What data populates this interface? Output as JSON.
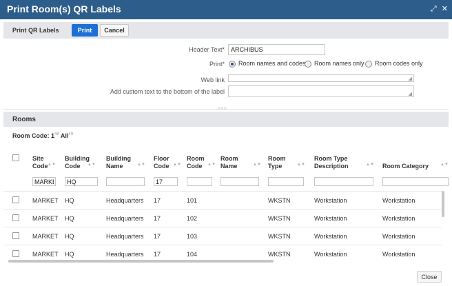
{
  "window": {
    "title": "Print Room(s) QR Labels",
    "icons": [
      "expand-icon",
      "close-icon"
    ],
    "expand_glyph": "⤢",
    "close_glyph": "✕"
  },
  "actionbar": {
    "label": "Print QR Labels",
    "print_button": "Print",
    "cancel_button": "Cancel"
  },
  "form": {
    "header_text_label": "Header Text*",
    "header_text_value": "ARCHIBUS",
    "print_label": "Print*",
    "print_options": [
      "Room names and codes",
      "Room names only",
      "Room codes only"
    ],
    "print_selected": "Room names and codes",
    "web_link_label": "Web link",
    "web_link_value": "",
    "custom_text_label": "Add custom text to the bottom of the label",
    "custom_text_value": ""
  },
  "rooms": {
    "title": "Rooms",
    "filter_label": "Room Code:",
    "filter_selected": "1",
    "filter_selected_count": "49",
    "filter_all": "All",
    "filter_all_count": "49",
    "columns": [
      {
        "line1": "Site",
        "line2": "Code"
      },
      {
        "line1": "Building",
        "line2": "Code"
      },
      {
        "line1": "Building",
        "line2": "Name"
      },
      {
        "line1": "Floor",
        "line2": "Code"
      },
      {
        "line1": "Room",
        "line2": "Code"
      },
      {
        "line1": "Room",
        "line2": "Name"
      },
      {
        "line1": "Room",
        "line2": "Type"
      },
      {
        "line1": "Room Type",
        "line2": "Description"
      },
      {
        "line1": "",
        "line2": "Room Category"
      }
    ],
    "filters": [
      "MARKET",
      "HQ",
      "",
      "17",
      "",
      "",
      "",
      "",
      ""
    ],
    "rows": [
      [
        "MARKET",
        "HQ",
        "Headquarters",
        "17",
        "101",
        "",
        "WKSTN",
        "Workstation",
        "Workstation"
      ],
      [
        "MARKET",
        "HQ",
        "Headquarters",
        "17",
        "102",
        "",
        "WKSTN",
        "Workstation",
        "Workstation"
      ],
      [
        "MARKET",
        "HQ",
        "Headquarters",
        "17",
        "103",
        "",
        "WKSTN",
        "Workstation",
        "Workstation"
      ],
      [
        "MARKET",
        "HQ",
        "Headquarters",
        "17",
        "104",
        "",
        "WKSTN",
        "Workstation",
        "Workstation"
      ]
    ]
  },
  "footer": {
    "close_button": "Close"
  },
  "colors": {
    "titlebar": "#2d5d8b",
    "primary_button": "#1c6fd4",
    "panel_header": "#e4e6e9"
  }
}
